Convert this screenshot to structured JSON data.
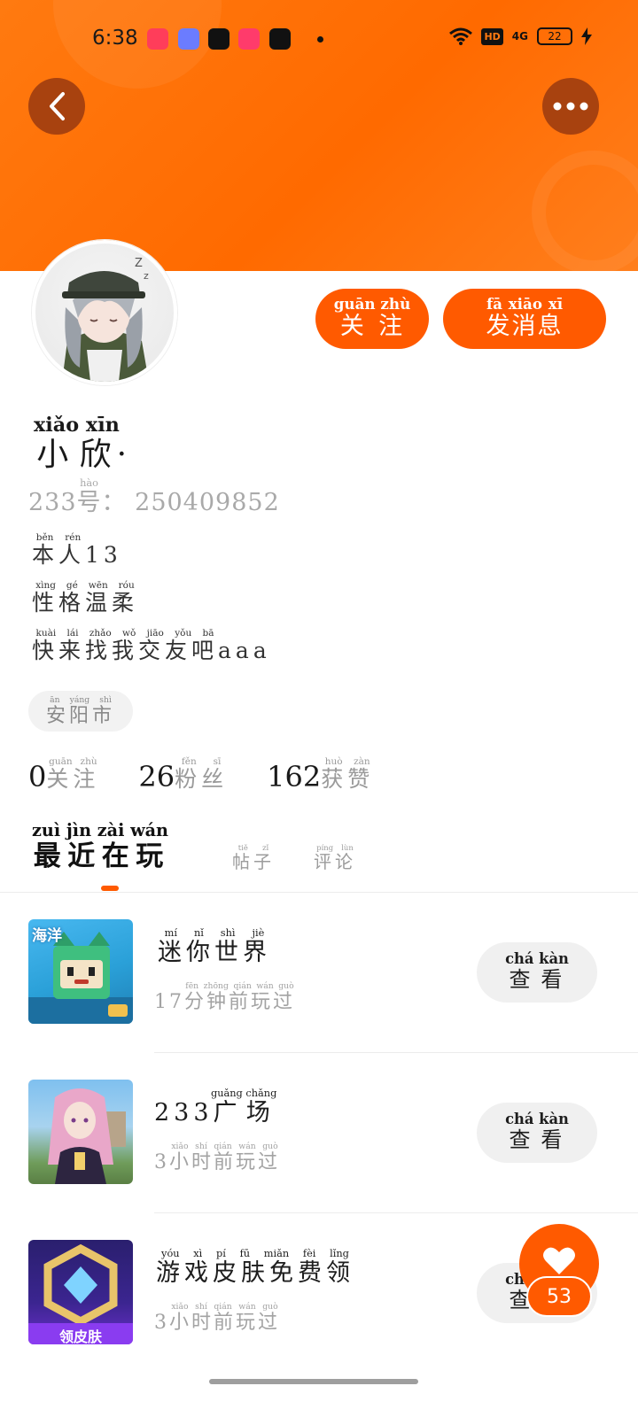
{
  "status_bar": {
    "time": "6:38",
    "hd": "HD",
    "network": "4G",
    "battery": "22"
  },
  "header": {
    "back_icon": "chevron-left-icon",
    "more_icon": "more-dots-icon",
    "accent": "#ff6a00"
  },
  "actions": {
    "follow_label": "关注",
    "follow_pinyin": "guān zhù",
    "message_label": "发消息",
    "message_pinyin": "fā xiāo xī"
  },
  "profile": {
    "name": "小欣",
    "name_pinyin": "xiǎo xīn",
    "name_suffix": "·",
    "id_prefix": "233",
    "id_char": "号",
    "id_char_pinyin": "hào",
    "id_sep": "：",
    "id_value": "250409852",
    "bio": [
      {
        "text": "本人",
        "pinyin": "běn rén",
        "suffix": "13"
      },
      {
        "text": "性格温柔",
        "pinyin": "xìng gé wēn róu",
        "suffix": ""
      },
      {
        "text": "快来找我交友吧",
        "pinyin": "kuài lái zhǎo wǒ jiāo yǒu bā",
        "suffix": "aaa"
      }
    ],
    "location": "安阳市",
    "location_pinyin": "ān yáng shì"
  },
  "stats": {
    "following_count": "0",
    "following_label": "关注",
    "following_pinyin": "guān zhù",
    "fans_count": "26",
    "fans_label": "粉丝",
    "fans_pinyin": "fěn sī",
    "likes_count": "162",
    "likes_label": "获赞",
    "likes_pinyin": "huò zàn"
  },
  "tabs": {
    "recent": "最近在玩",
    "recent_pinyin": "zuì jìn zài wán",
    "posts": "帖子",
    "posts_pinyin": "tiě zǐ",
    "comments": "评论",
    "comments_pinyin": "píng lùn"
  },
  "games": [
    {
      "title_prefix": "",
      "title": "迷你世界",
      "title_pinyin": "mí nǐ shì jiè",
      "sub_prefix": "17",
      "sub": "分钟前玩过",
      "sub_pinyin": "fēn zhōng qián wán guò",
      "thumb_label": "海洋",
      "button": "查看",
      "button_pinyin": "chá kàn"
    },
    {
      "title_prefix": "233",
      "title": "广场",
      "title_pinyin": "guǎng chǎng",
      "sub_prefix": "3",
      "sub": "小时前玩过",
      "sub_pinyin": "xiǎo shí qián wán guò",
      "thumb_label": "",
      "button": "查看",
      "button_pinyin": "chá kàn"
    },
    {
      "title_prefix": "",
      "title": "游戏皮肤免费领",
      "title_pinyin": "yóu xì pí fū miǎn fèi lǐng",
      "sub_prefix": "3",
      "sub": "小时前玩过",
      "sub_pinyin": "xiǎo shí qián wán guò",
      "thumb_label": "领皮肤",
      "button": "查看",
      "button_pinyin": "chá kàn"
    }
  ],
  "fab": {
    "icon": "heart-icon",
    "count": "53"
  }
}
